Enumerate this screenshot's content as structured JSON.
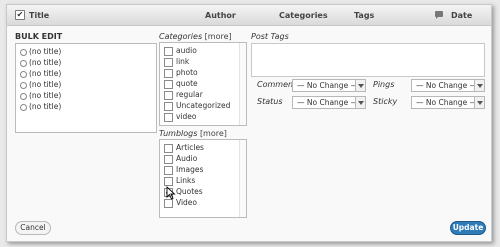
{
  "header": {
    "title": "Title",
    "author": "Author",
    "categories": "Categories",
    "tags": "Tags",
    "date": "Date",
    "select_all_checked": true
  },
  "bulk": {
    "heading": "BULK EDIT",
    "items": [
      "(no title)",
      "(no title)",
      "(no title)",
      "(no title)",
      "(no title)",
      "(no title)"
    ]
  },
  "categories": {
    "label": "Categories",
    "more": "[more]",
    "items": [
      {
        "label": "audio",
        "checked": false
      },
      {
        "label": "link",
        "checked": false
      },
      {
        "label": "photo",
        "checked": false
      },
      {
        "label": "quote",
        "checked": false
      },
      {
        "label": "regular",
        "checked": false
      },
      {
        "label": "Uncategorized",
        "checked": false
      },
      {
        "label": "video",
        "checked": false
      }
    ]
  },
  "tumblogs": {
    "label": "Tumblogs",
    "more": "[more]",
    "items": [
      {
        "label": "Articles",
        "checked": false
      },
      {
        "label": "Audio",
        "checked": false
      },
      {
        "label": "Images",
        "checked": false
      },
      {
        "label": "Links",
        "checked": false
      },
      {
        "label": "Quotes",
        "checked": true
      },
      {
        "label": "Video",
        "checked": false
      }
    ]
  },
  "post_tags": {
    "label": "Post Tags",
    "value": ""
  },
  "fields": {
    "comments": {
      "label": "Comments",
      "value": "— No Change —"
    },
    "pings": {
      "label": "Pings",
      "value": "— No Change —"
    },
    "status": {
      "label": "Status",
      "value": "— No Change —"
    },
    "sticky": {
      "label": "Sticky",
      "value": "— No Change —"
    }
  },
  "buttons": {
    "cancel": "Cancel",
    "update": "Update"
  },
  "colors": {
    "update_bg": "#2e7bb8",
    "frame_bg": "#f9f9f9"
  },
  "icons": {
    "comments_column": "comment-bubble-icon",
    "cursor": "mouse-pointer-icon"
  }
}
